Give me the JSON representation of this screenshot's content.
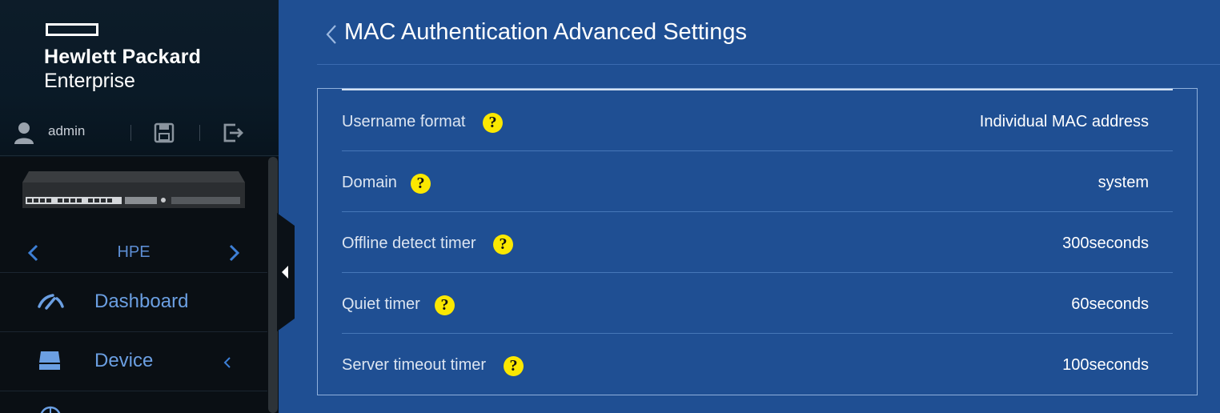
{
  "brand": {
    "line1": "Hewlett Packard",
    "line2": "Enterprise"
  },
  "user": {
    "name": "admin",
    "user_icon": "user-icon",
    "save_icon": "save-icon",
    "logout_icon": "logout-icon"
  },
  "device": {
    "name": "HPE"
  },
  "menu": [
    {
      "label": "Dashboard",
      "icon": "dashboard-icon"
    },
    {
      "label": "Device",
      "icon": "device-icon"
    }
  ],
  "page": {
    "title": "MAC Authentication Advanced Settings"
  },
  "settings": [
    {
      "label": "Username format",
      "value": "Individual MAC address"
    },
    {
      "label": "Domain",
      "value": "system"
    },
    {
      "label": "Offline detect timer",
      "value": "300seconds"
    },
    {
      "label": "Quiet timer",
      "value": "60seconds"
    },
    {
      "label": "Server timeout timer",
      "value": "100seconds"
    }
  ],
  "help_glyph": "?",
  "colors": {
    "background": "#1f4f93",
    "sidebar": "#0a0f14",
    "menu_text": "#6b9fe2",
    "help_badge": "#fbe800"
  }
}
